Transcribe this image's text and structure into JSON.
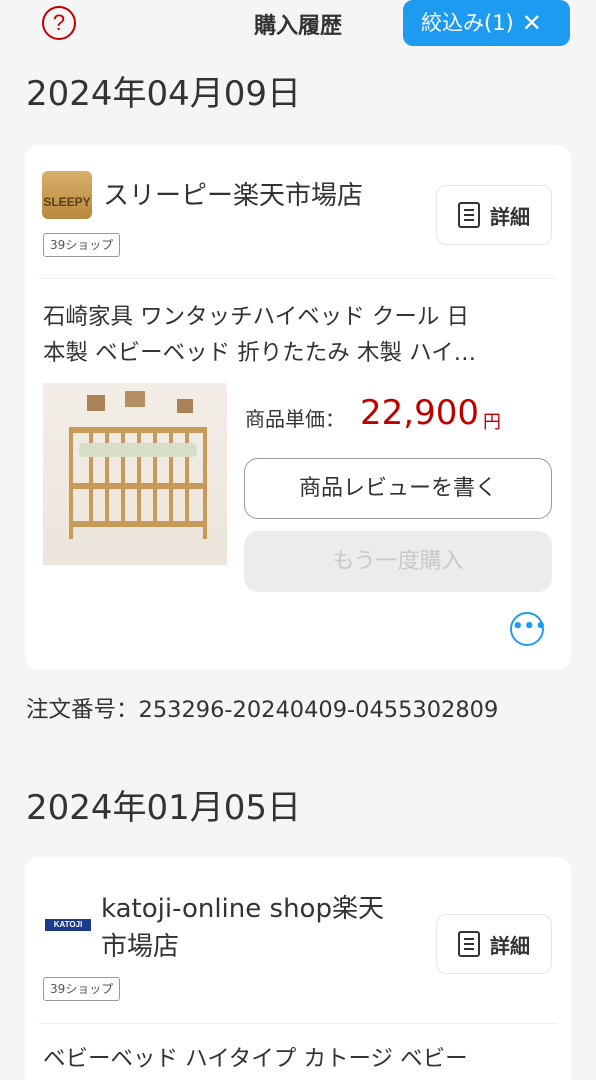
{
  "header": {
    "help_icon_glyph": "?",
    "title": "購入履歴",
    "filter_label": "絞込み(1)",
    "filter_close_glyph": "✕"
  },
  "orders": [
    {
      "date": "2024年04月09日",
      "shop_name": "スリーピー楽天市場店",
      "shop_logo_text": "SLEEPY",
      "badge": "39ショップ",
      "detail_label": "詳細",
      "product_title_line1": "石崎家具 ワンタッチハイベッド クール 日",
      "product_title_line2": "本製 ベビーベッド 折りたたみ 木製 ハイ…",
      "price_label": "商品単価：",
      "price_value": "22,900",
      "price_unit": "円",
      "review_label": "商品レビューを書く",
      "rebuy_label": "もう一度購入",
      "more_glyph": "•••",
      "order_number": "注文番号：253296-20240409-0455302809"
    },
    {
      "date": "2024年01月05日",
      "shop_name_line1": "katoji-online shop楽天",
      "shop_name_line2": "市場店",
      "shop_logo_text": "KATOJI",
      "badge": "39ショップ",
      "detail_label": "詳細",
      "product_title_line1": "ベビーベッド ハイタイプ カトージ ベビー"
    }
  ],
  "colors": {
    "accent_blue": "#1d9bf0",
    "price_red": "#bf0000",
    "background": "#f5f5f5"
  }
}
